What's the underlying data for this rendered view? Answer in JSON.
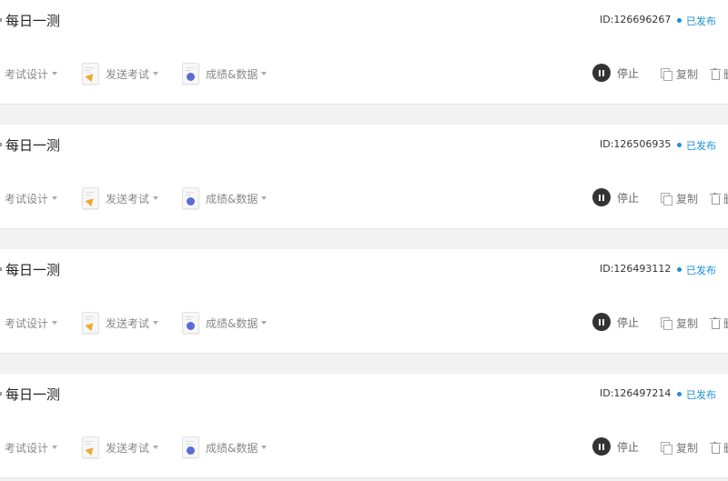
{
  "exams": [
    {
      "title": "每日一测",
      "id": "ID:126696267",
      "status": "已发布",
      "menu": {
        "design": "考试设计",
        "send": "发送考试",
        "score": "成绩&数据"
      },
      "actions": {
        "stop": "停止",
        "copy": "复制",
        "delete": "删除"
      }
    },
    {
      "title": "每日一测",
      "id": "ID:126506935",
      "status": "已发布",
      "menu": {
        "design": "考试设计",
        "send": "发送考试",
        "score": "成绩&数据"
      },
      "actions": {
        "stop": "停止",
        "copy": "复制",
        "delete": "删除"
      }
    },
    {
      "title": "每日一测",
      "id": "ID:126493112",
      "status": "已发布",
      "menu": {
        "design": "考试设计",
        "send": "发送考试",
        "score": "成绩&数据"
      },
      "actions": {
        "stop": "停止",
        "copy": "复制",
        "delete": "删除"
      }
    },
    {
      "title": "每日一测",
      "id": "ID:126497214",
      "status": "已发布",
      "menu": {
        "design": "考试设计",
        "send": "发送考试",
        "score": "成绩&数据"
      },
      "actions": {
        "stop": "停止",
        "copy": "复制",
        "delete": "删除"
      }
    }
  ],
  "icons": {
    "status": "status-dot-icon",
    "send": "send-document-icon",
    "score": "chart-document-icon",
    "stop": "pause-icon",
    "copy": "copy-icon",
    "delete": "trash-icon"
  },
  "colors": {
    "status_blue": "#1a8fd8",
    "send_orange": "#f0a830",
    "score_purple": "#5a6cd6",
    "pause_dark": "#333333"
  }
}
